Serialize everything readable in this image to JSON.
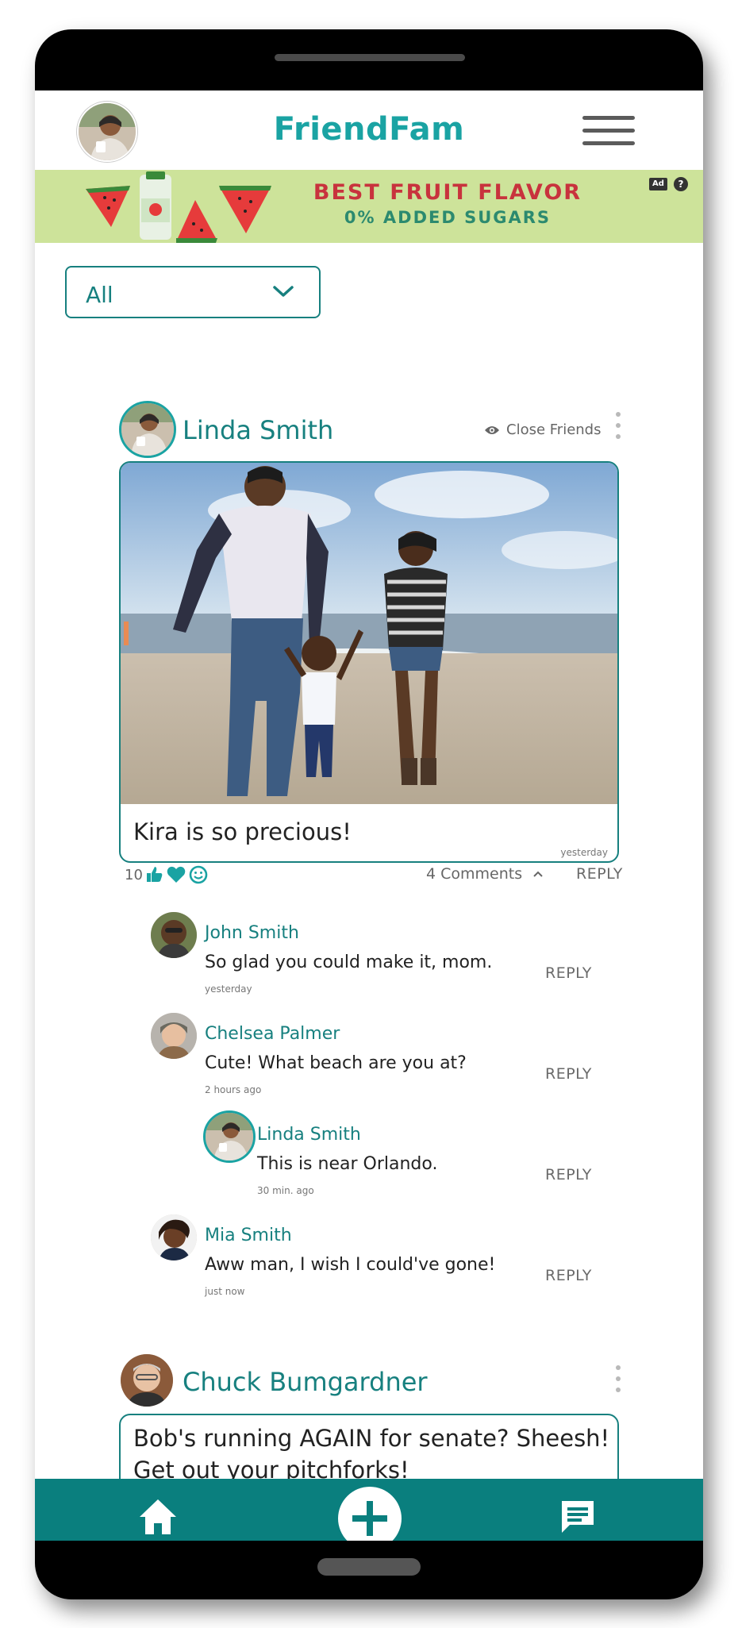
{
  "app": {
    "name": "FriendFam"
  },
  "header": {
    "menu_icon": "hamburger-menu-icon"
  },
  "ad": {
    "headline": "BEST FRUIT FLAVOR",
    "subline": "0% ADDED SUGARS",
    "badge": "Ad",
    "help": "?"
  },
  "filter": {
    "value": "All"
  },
  "posts": [
    {
      "author": "Linda Smith",
      "visibility": "Close Friends",
      "caption": "Kira is so precious!",
      "time": "yesterday",
      "likes": "10",
      "reactions": [
        "thumbs-up-icon",
        "heart-icon",
        "smile-icon"
      ],
      "comments_label": "4 Comments",
      "reply_label": "REPLY",
      "comments": [
        {
          "name": "John Smith",
          "text": "So glad you could make it, mom.",
          "time": "yesterday",
          "reply": "REPLY"
        },
        {
          "name": "Chelsea Palmer",
          "text": "Cute! What beach are you at?",
          "time": "2 hours ago",
          "reply": "REPLY"
        },
        {
          "name": "Linda Smith",
          "text": "This is near Orlando.",
          "time": "30 min. ago",
          "reply": "REPLY"
        },
        {
          "name": "Mia Smith",
          "text": "Aww man, I wish I could've gone!",
          "time": "just now",
          "reply": "REPLY"
        }
      ]
    },
    {
      "author": "Chuck Bumgardner",
      "text_line1": "Bob's running AGAIN for senate? Sheesh!",
      "text_line2": "Get out your pitchforks!"
    }
  ],
  "nav": {
    "home": "home-icon",
    "add": "plus-icon",
    "messages": "chat-icon"
  },
  "colors": {
    "brand": "#1aa3a3",
    "brand_dark": "#0a7f7e",
    "ad_bg": "#cde39a"
  }
}
